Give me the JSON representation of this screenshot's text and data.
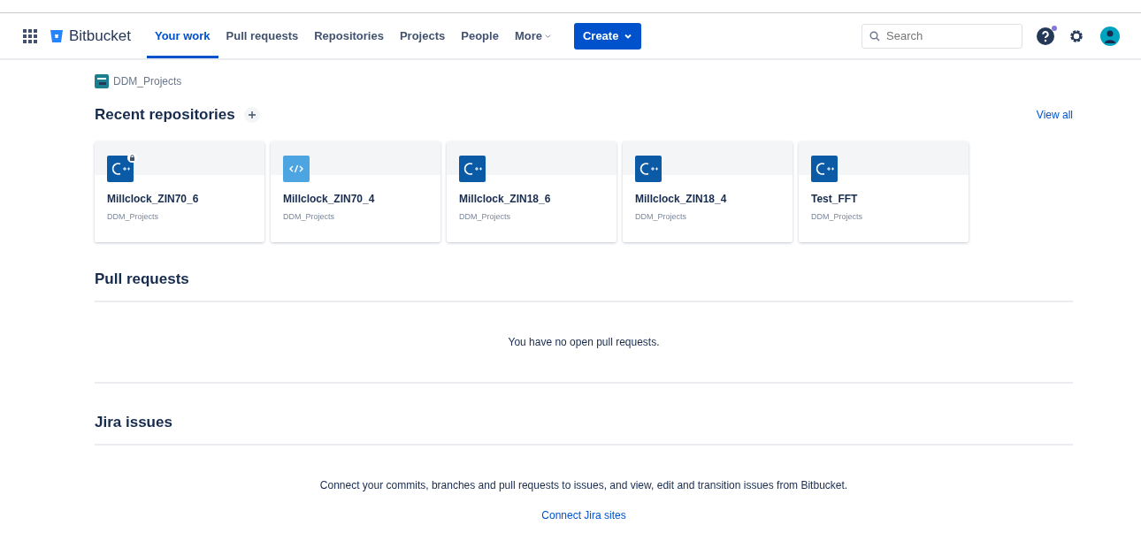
{
  "nav": {
    "brand": "Bitbucket",
    "items": [
      {
        "label": "Your work",
        "selected": true
      },
      {
        "label": "Pull requests",
        "selected": false
      },
      {
        "label": "Repositories",
        "selected": false
      },
      {
        "label": "Projects",
        "selected": false
      },
      {
        "label": "People",
        "selected": false
      }
    ],
    "more": "More",
    "create": "Create",
    "search": {
      "placeholder": "Search"
    },
    "help_notification": true
  },
  "breadcrumb": "DDM_Projects",
  "recent": {
    "title": "Recent repositories",
    "view_all": "View all",
    "repos": [
      {
        "name": "Millclock_ZIN70_6",
        "project": "DDM_Projects",
        "kind": "cpp",
        "private": true
      },
      {
        "name": "Millclock_ZIN70_4",
        "project": "DDM_Projects",
        "kind": "code",
        "private": false
      },
      {
        "name": "Millclock_ZIN18_6",
        "project": "DDM_Projects",
        "kind": "cpp",
        "private": false
      },
      {
        "name": "Millclock_ZIN18_4",
        "project": "DDM_Projects",
        "kind": "cpp",
        "private": false
      },
      {
        "name": "Test_FFT",
        "project": "DDM_Projects",
        "kind": "cpp",
        "private": false
      }
    ]
  },
  "pull_requests": {
    "title": "Pull requests",
    "empty": "You have no open pull requests."
  },
  "jira": {
    "title": "Jira issues",
    "text": "Connect your commits, branches and pull requests to issues, and view, edit and transition issues from Bitbucket.",
    "link": "Connect Jira sites"
  }
}
